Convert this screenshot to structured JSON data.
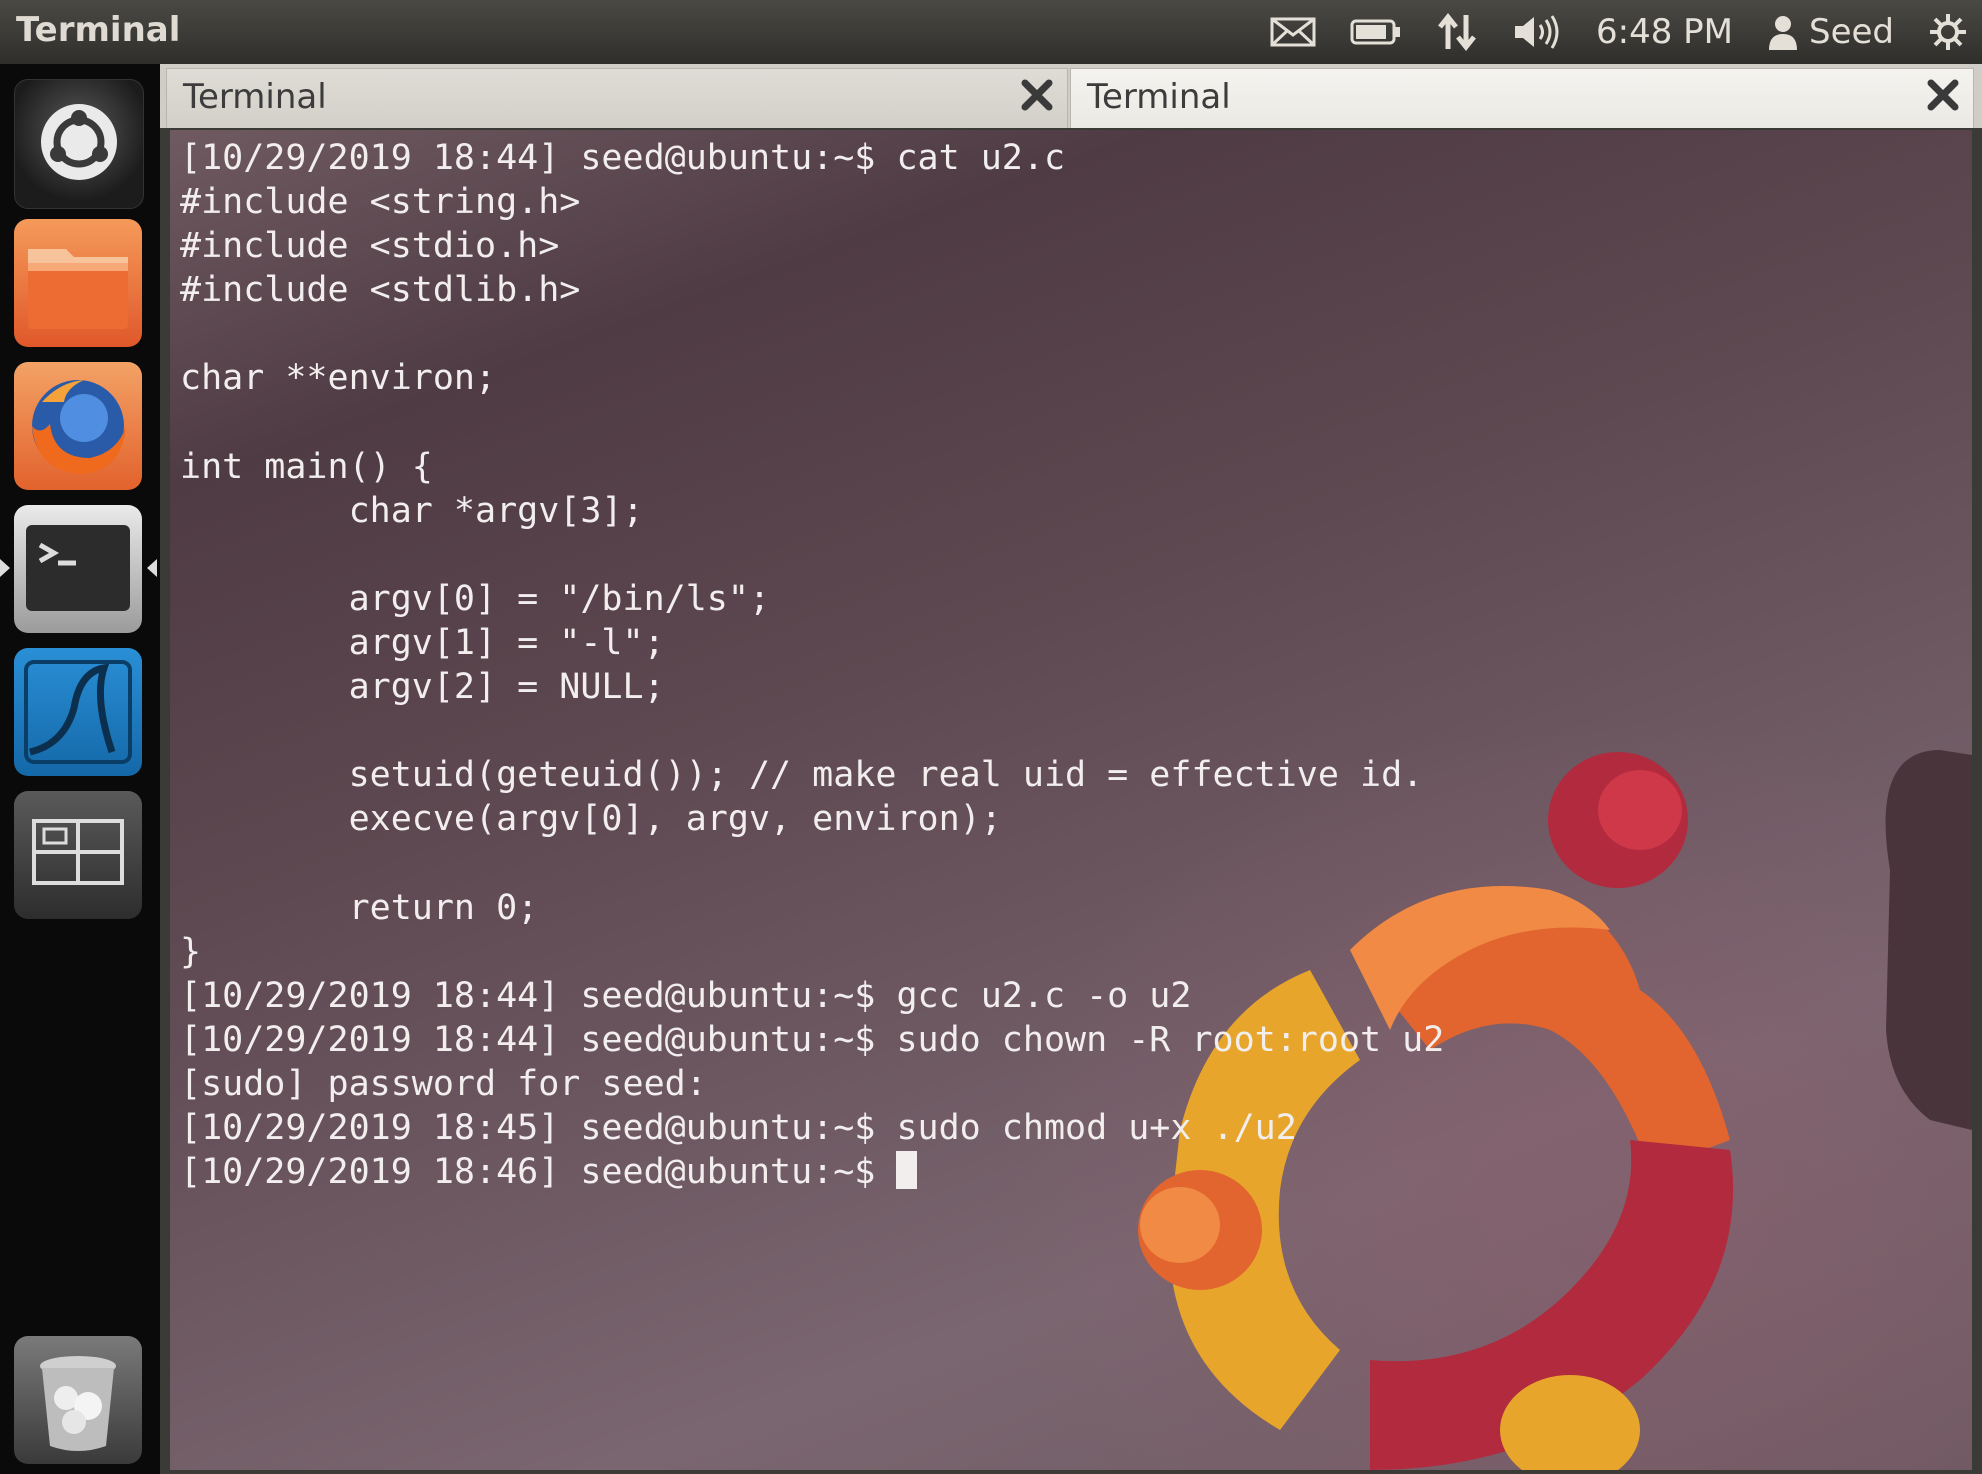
{
  "top_panel": {
    "app_title": "Terminal",
    "indicators": {
      "mail": "mail-icon",
      "battery": "battery-icon",
      "network": "network-icon",
      "volume": "volume-icon",
      "clock": "6:48 PM",
      "user": "Seed",
      "power": "power-icon"
    }
  },
  "launcher": {
    "items": [
      "dash-home-icon",
      "files-folder-icon",
      "firefox-icon",
      "terminal-app-icon",
      "wireshark-icon",
      "workspace-switcher-icon",
      "trash-icon"
    ],
    "active": "terminal-app-icon"
  },
  "window": {
    "tabs": [
      {
        "label": "Terminal",
        "active": false
      },
      {
        "label": "Terminal",
        "active": true
      }
    ]
  },
  "terminal": {
    "lines": [
      "[10/29/2019 18:44] seed@ubuntu:~$ cat u2.c",
      "#include <string.h>",
      "#include <stdio.h>",
      "#include <stdlib.h>",
      "",
      "char **environ;",
      "",
      "int main() {",
      "        char *argv[3];",
      "",
      "        argv[0] = \"/bin/ls\";",
      "        argv[1] = \"-l\";",
      "        argv[2] = NULL;",
      "",
      "        setuid(geteuid()); // make real uid = effective id.",
      "        execve(argv[0], argv, environ);",
      "",
      "        return 0;",
      "}",
      "[10/29/2019 18:44] seed@ubuntu:~$ gcc u2.c -o u2",
      "[10/29/2019 18:44] seed@ubuntu:~$ sudo chown -R root:root u2",
      "[sudo] password for seed:",
      "[10/29/2019 18:45] seed@ubuntu:~$ sudo chmod u+x ./u2"
    ],
    "prompt": "[10/29/2019 18:46] seed@ubuntu:~$ "
  },
  "colors": {
    "panel": "#3c3b37",
    "launcher": "#0a0a0a",
    "terminal_text": "#f2eeee",
    "wallpaper_base": "#5e4851",
    "logo_orange": "#e2642e",
    "logo_red": "#b22a3e",
    "logo_yellow": "#e8a52c"
  }
}
